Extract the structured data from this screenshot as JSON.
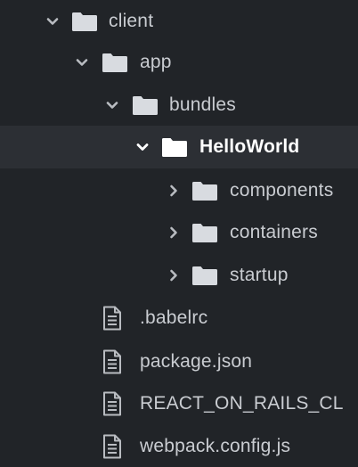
{
  "tree": {
    "folders": {
      "client": {
        "label": "client",
        "expanded": true
      },
      "app": {
        "label": "app",
        "expanded": true
      },
      "bundles": {
        "label": "bundles",
        "expanded": true
      },
      "helloworld": {
        "label": "HelloWorld",
        "expanded": true,
        "selected": true
      },
      "components": {
        "label": "components",
        "expanded": false
      },
      "containers": {
        "label": "containers",
        "expanded": false
      },
      "startup": {
        "label": "startup",
        "expanded": false
      }
    },
    "files": {
      "babelrc": {
        "label": ".babelrc"
      },
      "package_json": {
        "label": "package.json"
      },
      "react_on_rails": {
        "label": "REACT_ON_RAILS_CL"
      },
      "webpack_config": {
        "label": "webpack.config.js"
      }
    }
  },
  "icons": {
    "folder": "folder-icon",
    "file": "file-icon",
    "expanded": "chevron-down-icon",
    "collapsed": "chevron-right-icon"
  },
  "colors": {
    "background": "#212428",
    "selected_row": "#2c2f34",
    "text": "#c9ccd1",
    "selected_text": "#ffffff",
    "folder": "#d8dbe0",
    "file": "#b9bcc1"
  }
}
